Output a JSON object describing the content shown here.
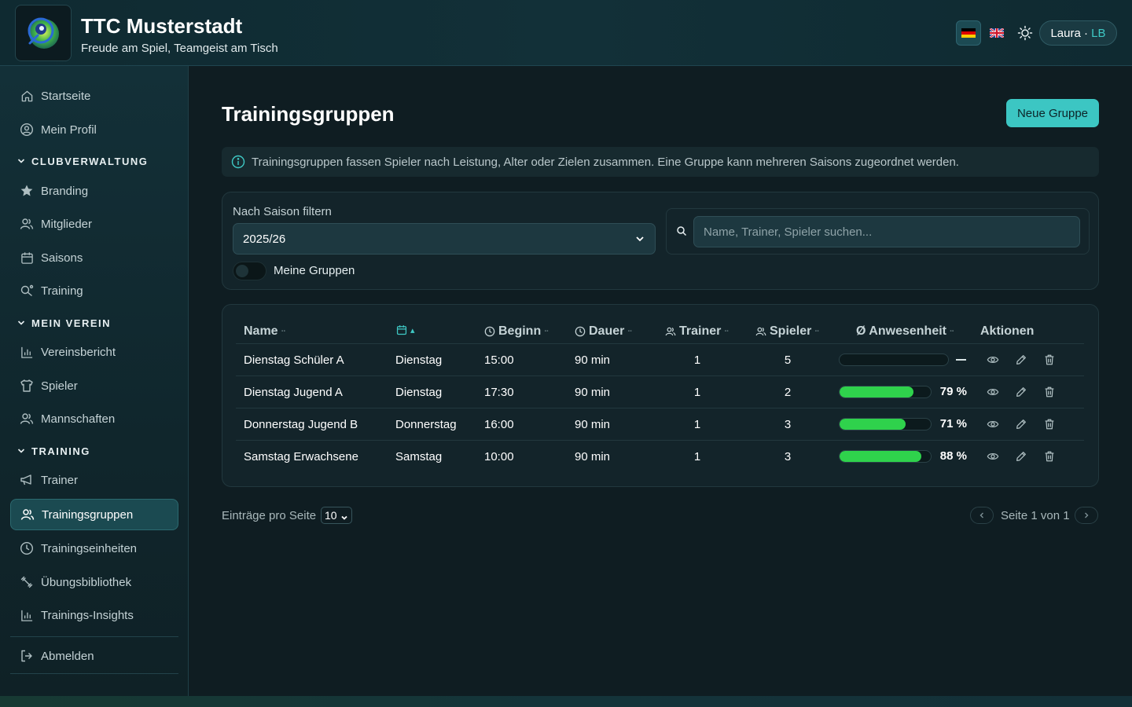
{
  "header": {
    "title": "TTC Musterstadt",
    "subtitle": "Freude am Spiel, Teamgeist am Tisch",
    "user_name": "Laura",
    "user_sep": " · ",
    "user_initials": "LB"
  },
  "sidebar": {
    "startseite": "Startseite",
    "profil": "Mein Profil",
    "sec_club": "CLUBVERWALTUNG",
    "branding": "Branding",
    "mitglieder": "Mitglieder",
    "saisons": "Saisons",
    "training": "Training",
    "sec_verein": "MEIN VEREIN",
    "vereinsbericht": "Vereinsbericht",
    "spieler": "Spieler",
    "mannschaften": "Mannschaften",
    "sec_training": "TRAINING",
    "trainer": "Trainer",
    "trainingsgruppen": "Trainingsgruppen",
    "trainingseinheiten": "Trainingseinheiten",
    "uebungsbibliothek": "Übungsbibliothek",
    "insights": "Trainings-Insights",
    "abmelden": "Abmelden"
  },
  "main": {
    "title": "Trainingsgruppen",
    "new_button": "Neue Gruppe",
    "info": "Trainingsgruppen fassen Spieler nach Leistung, Alter oder Zielen zusammen. Eine Gruppe kann mehreren Saisons zugeordnet werden.",
    "filter_label": "Nach Saison filtern",
    "season_value": "2025/26",
    "toggle_label": "Meine Gruppen",
    "search_placeholder": "Name, Trainer, Spieler suchen..."
  },
  "table": {
    "columns": {
      "name": "Name",
      "day_sort": "▴",
      "begin": "Beginn",
      "duration": "Dauer",
      "trainer": "Trainer",
      "players": "Spieler",
      "attendance": "Ø Anwesenheit",
      "actions": "Aktionen",
      "sort_mark": "··"
    },
    "rows": [
      {
        "name": "Dienstag Schüler A",
        "day": "Dienstag",
        "begin": "15:00",
        "duration": "90 min",
        "trainer": "1",
        "players": "5",
        "attendance": null,
        "attendance_label": ""
      },
      {
        "name": "Dienstag Jugend A",
        "day": "Dienstag",
        "begin": "17:30",
        "duration": "90 min",
        "trainer": "1",
        "players": "2",
        "attendance": 79,
        "attendance_label": "79 %"
      },
      {
        "name": "Donnerstag Jugend B",
        "day": "Donnerstag",
        "begin": "16:00",
        "duration": "90 min",
        "trainer": "1",
        "players": "3",
        "attendance": 71,
        "attendance_label": "71 %"
      },
      {
        "name": "Samstag Erwachsene",
        "day": "Samstag",
        "begin": "10:00",
        "duration": "90 min",
        "trainer": "1",
        "players": "3",
        "attendance": 88,
        "attendance_label": "88 %"
      }
    ]
  },
  "pager": {
    "per_page_label": "Einträge pro Seite",
    "per_page_value": "10",
    "page_info": "Seite 1 von 1"
  },
  "colors": {
    "accent": "#3cc6c3",
    "progress": "#2fd24c",
    "background": "#0f1d22"
  }
}
